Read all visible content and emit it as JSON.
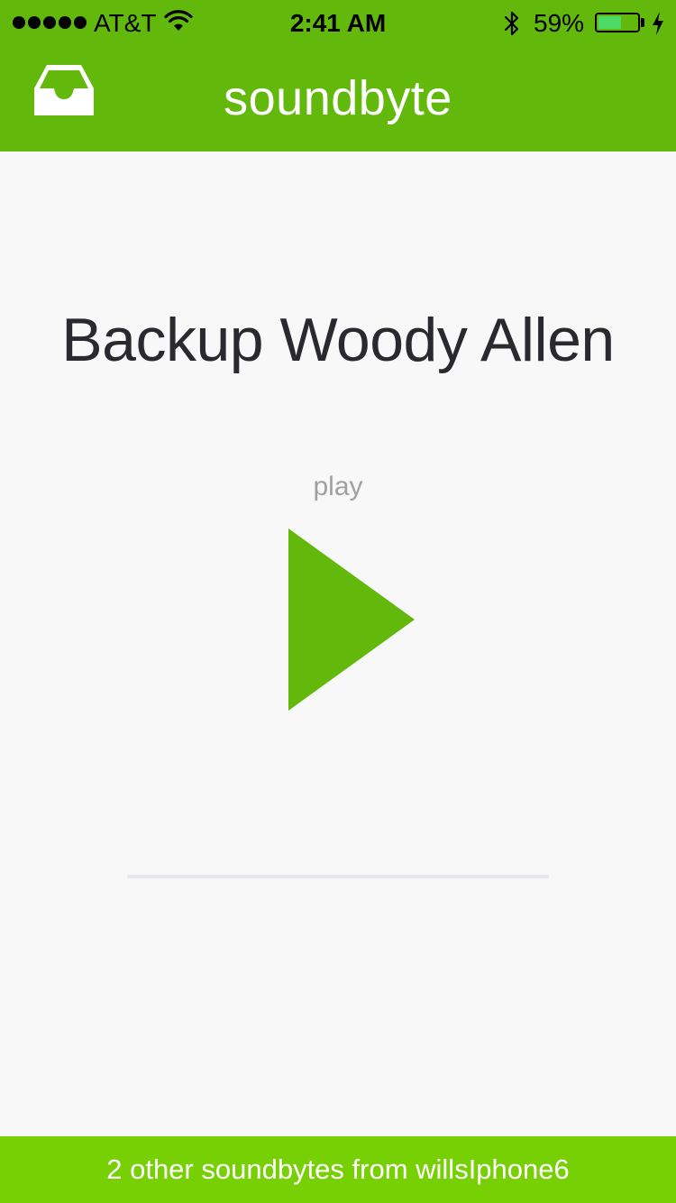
{
  "status_bar": {
    "carrier": "AT&T",
    "time": "2:41 AM",
    "battery_percent": "59%",
    "battery_level": 0.59,
    "signal_strength": 5,
    "icons": [
      "signal-dots-icon",
      "wifi-icon",
      "bluetooth-icon",
      "battery-icon",
      "charging-bolt-icon"
    ]
  },
  "nav": {
    "title": "soundbyte",
    "left_icon": "inbox-icon"
  },
  "player": {
    "title": "Backup Woody Allen",
    "play_label": "play",
    "play_icon": "play-icon",
    "progress": 0
  },
  "footer": {
    "text": "2 other soundbytes from willsIphone6"
  },
  "colors": {
    "brand_green": "#62b80b",
    "footer_green": "#77d004",
    "background": "#f8f8f8",
    "title_text": "#2a2a2e",
    "label_gray": "#a0a0a0"
  }
}
